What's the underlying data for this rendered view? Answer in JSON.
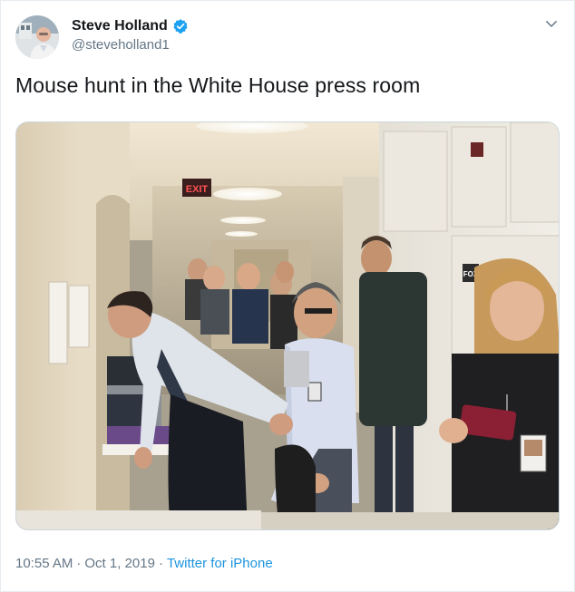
{
  "tweet": {
    "author": {
      "display_name": "Steve Holland",
      "handle": "@steveholland1",
      "verified": true,
      "avatar_icon": "avatar-photo"
    },
    "text": "Mouse hunt in the White House press room",
    "timestamp": "10:55 AM",
    "date": "Oct 1, 2019",
    "separator": "·",
    "source": "Twitter for iPhone",
    "menu_icon": "chevron-down-icon",
    "media": {
      "description_icon": "photo",
      "exit_sign": "EXIT",
      "logo_text": "FOX"
    }
  },
  "colors": {
    "verified": "#1da1f2",
    "link": "#1b95e0",
    "meta": "#657786",
    "text": "#14171a"
  }
}
